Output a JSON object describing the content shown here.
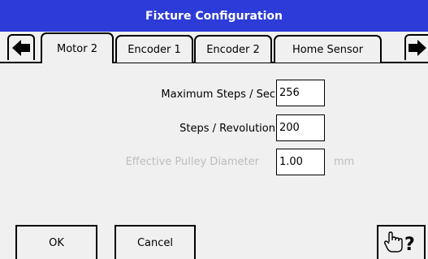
{
  "window": {
    "title": "Fixture Configuration"
  },
  "tabs": [
    {
      "label": "Motor 2",
      "active": true
    },
    {
      "label": "Encoder 1",
      "active": false
    },
    {
      "label": "Encoder 2",
      "active": false
    },
    {
      "label": "Home Sensor",
      "active": false
    }
  ],
  "nav": {
    "prev_icon": "arrow-left-icon",
    "next_icon": "arrow-right-icon"
  },
  "form": {
    "max_steps": {
      "label": "Maximum Steps / Sec",
      "value": "256"
    },
    "steps_rev": {
      "label": "Steps / Revolution",
      "value": "200"
    },
    "pulley": {
      "label": "Effective Pulley Diameter",
      "value": "1.00",
      "unit": "mm",
      "disabled": true
    }
  },
  "buttons": {
    "ok": "OK",
    "cancel": "Cancel",
    "help_icon": "hand-question-icon"
  },
  "colors": {
    "title_bar": "#2d3bd8",
    "background": "#f0f0f0",
    "disabled_text": "#bdbdbd"
  }
}
